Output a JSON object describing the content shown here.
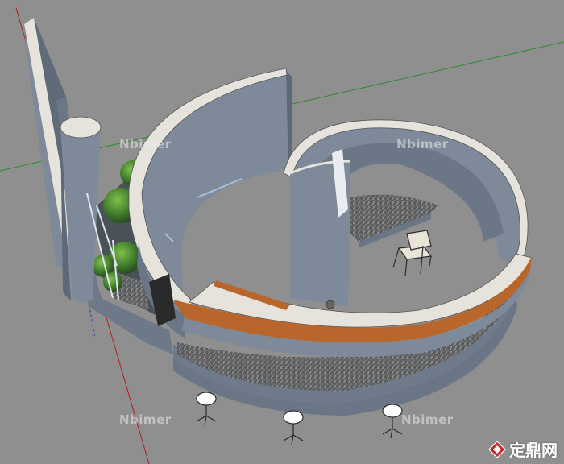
{
  "scene": {
    "kind": "3D model viewport of a spiral curved-wall pavilion with bench seating, gravel beds, planters, a chair and stools"
  },
  "watermarks": [
    {
      "text": "Nbimer"
    },
    {
      "text": "Nbimer"
    },
    {
      "text": "Nbimer"
    },
    {
      "text": "Nbimer"
    }
  ],
  "brand": {
    "text": "定鼎网"
  },
  "colors": {
    "background": "#8f8f8f",
    "wall": "#7e8a99",
    "wall_top": "#e6e3dc",
    "bench_wood": "#b8662b",
    "gravel": "#6a6c6c",
    "foliage": "#3f7a2c",
    "axis_red": "#b02020",
    "axis_green": "#2a8a2a"
  }
}
